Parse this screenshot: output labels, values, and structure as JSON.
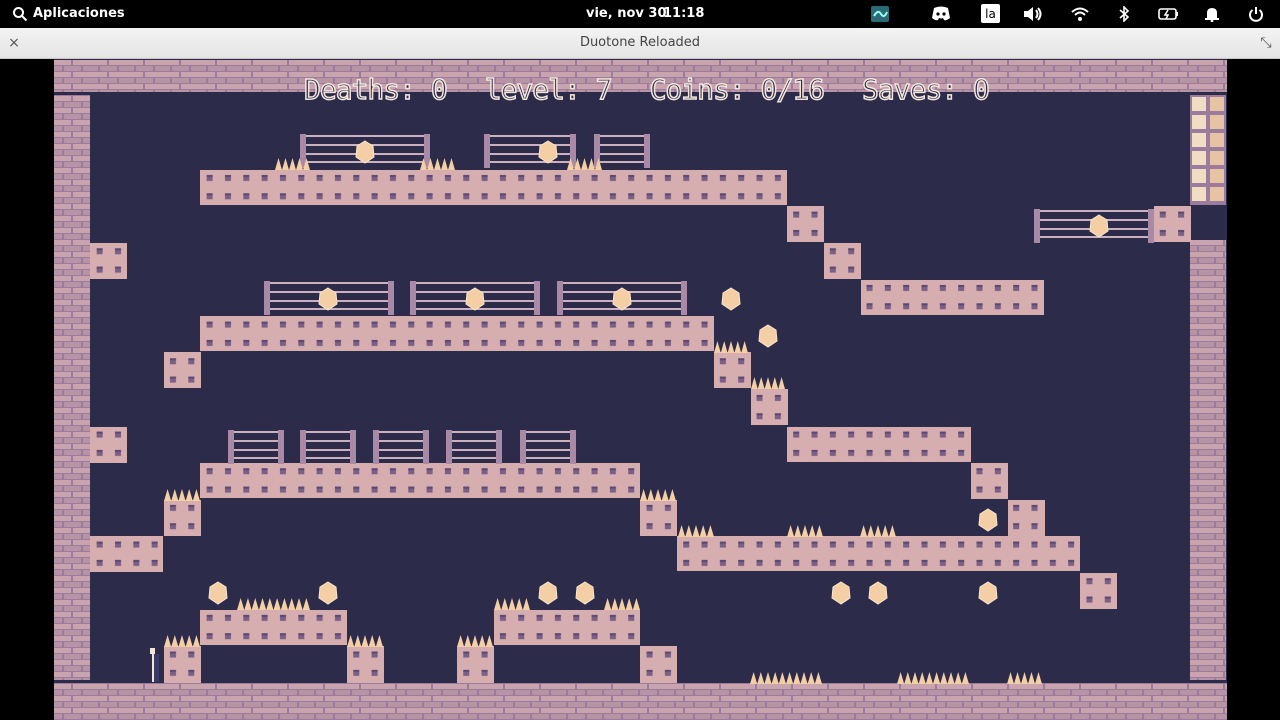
{
  "top_panel": {
    "apps_label": "Aplicaciones",
    "date": "vie, nov 30",
    "time": "11:18",
    "keyboard_layout": "la",
    "tray_icons": [
      "app-indicator-icon",
      "discord-icon",
      "keyboard-layout-indicator",
      "volume-icon",
      "wifi-icon",
      "bluetooth-icon",
      "battery-icon",
      "notifications-bell-icon",
      "power-icon"
    ]
  },
  "window": {
    "title": "Duotone Reloaded",
    "close_glyph": "×",
    "maximize_glyph": "⤡"
  },
  "hud": {
    "deaths": "Deaths: 0",
    "level": "level: 7",
    "coins": "Coins: 0/16",
    "saves": "Saves: 0"
  },
  "colors": {
    "background": "#2d2b4a",
    "block": "#d7aeb0",
    "block_dot": "#7a5f86",
    "brick": "#c9a3ad",
    "spike": "#f4cfa5",
    "coin": "#f4cfa5",
    "text_outline": "#f2e6dc"
  }
}
